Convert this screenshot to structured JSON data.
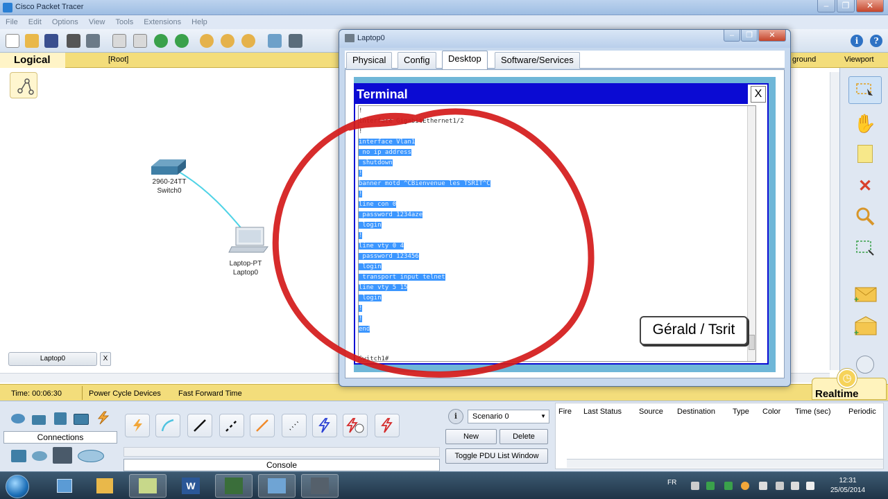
{
  "app": {
    "title": "Cisco Packet Tracer"
  },
  "menu": [
    "File",
    "Edit",
    "Options",
    "View",
    "Tools",
    "Extensions",
    "Help"
  ],
  "workspace": {
    "mode_label": "Logical",
    "root_label": "[Root]",
    "background_label": "ground",
    "viewport_label": "Viewport",
    "switch": {
      "model": "2960-24TT",
      "name": "Switch0"
    },
    "laptop": {
      "model": "Laptop-PT",
      "name": "Laptop0"
    }
  },
  "window_tab": {
    "label": "Laptop0",
    "close": "X"
  },
  "timebar": {
    "time": "Time: 00:06:30",
    "power_cycle": "Power Cycle Devices",
    "fast_forward": "Fast Forward Time",
    "realtime": "Realtime"
  },
  "bottom": {
    "connections_label": "Connections",
    "console_label": "Console",
    "scenario": "Scenario 0",
    "new_label": "New",
    "delete_label": "Delete",
    "toggle_pdu_label": "Toggle PDU List Window",
    "pdu_columns": [
      "Fire",
      "Last Status",
      "Source",
      "Destination",
      "Type",
      "Color",
      "Time (sec)",
      "Periodic"
    ]
  },
  "dialog": {
    "title": "Laptop0",
    "tabs": [
      "Physical",
      "Config",
      "Desktop",
      "Software/Services"
    ],
    "active_tab": "Desktop"
  },
  "terminal": {
    "title": "Terminal",
    "close": "X",
    "lines": [
      {
        "text": "!",
        "selected": false
      },
      {
        "text": "interface GigabitEthernet1/2",
        "selected": false
      },
      {
        "text": "!",
        "selected": false
      },
      {
        "text": "interface Vlan1",
        "selected": true
      },
      {
        "text": " no ip address",
        "selected": true
      },
      {
        "text": " shutdown",
        "selected": true
      },
      {
        "text": "!",
        "selected": true
      },
      {
        "text": "banner motd ^CBienvenue les TSRIT^C",
        "selected": true
      },
      {
        "text": "!",
        "selected": true
      },
      {
        "text": "line con 0",
        "selected": true
      },
      {
        "text": " password 1234aze",
        "selected": true
      },
      {
        "text": " login",
        "selected": true
      },
      {
        "text": "!",
        "selected": true
      },
      {
        "text": "line vty 0 4",
        "selected": true
      },
      {
        "text": " password 123456",
        "selected": true
      },
      {
        "text": " login",
        "selected": true
      },
      {
        "text": " transport input telnet",
        "selected": true
      },
      {
        "text": "line vty 5 15",
        "selected": true
      },
      {
        "text": " login",
        "selected": true
      },
      {
        "text": "!",
        "selected": true
      },
      {
        "text": "!",
        "selected": true
      },
      {
        "text": "end",
        "selected": true
      }
    ],
    "prompt": "Switch1#"
  },
  "watermark": "Gérald / Tsrit",
  "taskbar": {
    "lang": "FR",
    "time": "12:31",
    "date": "25/05/2014"
  },
  "colors": {
    "annotation": "#d41a1a",
    "selection": "#3b96ff",
    "terminal_title": "#0b0bd3",
    "realtime_bar": "#f3dd7b"
  }
}
